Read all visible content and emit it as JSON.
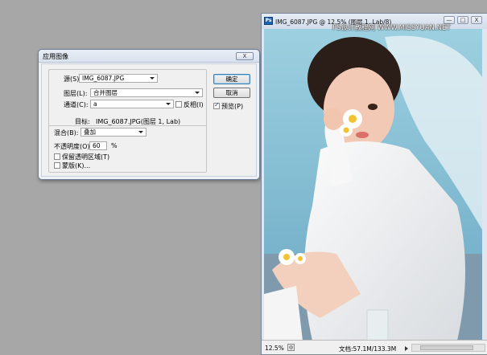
{
  "dialog": {
    "title": "应用图像",
    "close_label": "X",
    "source": {
      "label": "源(S):",
      "value": "IMG_6087.JPG"
    },
    "layer": {
      "label": "图层(L):",
      "value": "合并图层"
    },
    "channel": {
      "label": "通道(C):",
      "value": "a"
    },
    "invert": {
      "label": "反相(I)",
      "checked": false
    },
    "target": {
      "label": "目标:",
      "value": "IMG_6087.JPG(图层 1, Lab)"
    },
    "blending": {
      "label": "混合(B):",
      "value": "叠加"
    },
    "opacity": {
      "label": "不透明度(O):",
      "value": "60",
      "unit": "%"
    },
    "preserve_transparency": {
      "label": "保留透明区域(T)",
      "checked": false
    },
    "mask": {
      "label": "蒙版(K)...",
      "checked": false
    },
    "ok_label": "确定",
    "cancel_label": "取消",
    "preview": {
      "label": "预览(P)",
      "checked": true
    }
  },
  "document": {
    "title": "IMG_6087.JPG @ 12.5% (图层 1, Lab/8)",
    "watermark": "PS设计教程网",
    "watermark_url": "WWW.MISSYUAN.NET",
    "minimize_label": "—",
    "maximize_label": "□",
    "close_label": "X",
    "zoom": "12.5%",
    "doc_size": "文档:57.1M/133.3M"
  }
}
